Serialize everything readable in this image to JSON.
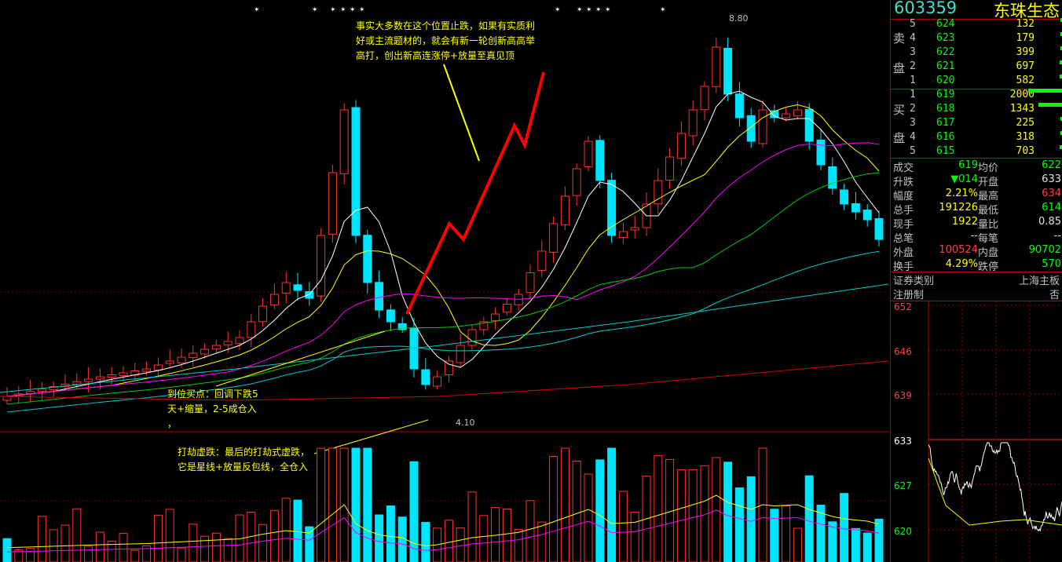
{
  "stock": {
    "code": "603359",
    "name": "东珠生态"
  },
  "chart": {
    "high_label": "8.80",
    "low_label": "4.10",
    "annotation_top": "事实大多数在这个位置止跌，如果有实质利\n好或主流题材的，就会有新一轮创新高高举\n高打，创出新高连涨停+放量至真见顶",
    "annotation_buy": "到位买点：回调下跌5\n天+缩量，2-5成仓入\n，",
    "annotation_fake": "打劫虚跌：最后的打劫式虚跌，\n它是星线+放量反包线，全仓入",
    "colors": {
      "up": "#ff3030",
      "down": "#00e5ff",
      "ma5": "#ffffff",
      "ma10": "#ffff00",
      "ma20": "#ff00ff",
      "ma30": "#00cc00",
      "ma60": "#ffffff",
      "ma120": "#00cccc",
      "ma250": "#cc0000"
    }
  },
  "orderbook": {
    "sell_label": [
      "卖",
      "盘"
    ],
    "buy_label": [
      "买",
      "盘"
    ],
    "sell": [
      {
        "lvl": "5",
        "price": "624",
        "vol": "132",
        "bar": 0.03
      },
      {
        "lvl": "4",
        "price": "623",
        "vol": "179",
        "bar": 0.04
      },
      {
        "lvl": "3",
        "price": "622",
        "vol": "399",
        "bar": 0.07
      },
      {
        "lvl": "2",
        "price": "621",
        "vol": "697",
        "bar": 0.1
      },
      {
        "lvl": "1",
        "price": "620",
        "vol": "582",
        "bar": 0.09
      }
    ],
    "buy": [
      {
        "lvl": "1",
        "price": "619",
        "vol": "2000",
        "bar": 1.0
      },
      {
        "lvl": "2",
        "price": "618",
        "vol": "1343",
        "bar": 0.7
      },
      {
        "lvl": "3",
        "price": "617",
        "vol": "225",
        "bar": 0.05
      },
      {
        "lvl": "4",
        "price": "616",
        "vol": "318",
        "bar": 0.05
      },
      {
        "lvl": "5",
        "price": "615",
        "vol": "703",
        "bar": 0.1
      }
    ]
  },
  "stats": [
    {
      "l1": "成交",
      "v1": "619",
      "c1": "grn",
      "l2": "均价",
      "v2": "622",
      "c2": "grn"
    },
    {
      "l1": "升跌",
      "v1": "▼014",
      "c1": "grn",
      "l2": "开盘",
      "v2": "633",
      "c2": "wht"
    },
    {
      "l1": "幅度",
      "v1": "2.21%",
      "c1": "yel",
      "l2": "最高",
      "v2": "634",
      "c2": "red"
    },
    {
      "l1": "总手",
      "v1": "191226",
      "c1": "yel",
      "l2": "最低",
      "v2": "614",
      "c2": "grn"
    },
    {
      "l1": "现手",
      "v1": "1922",
      "c1": "yel",
      "l2": "量比",
      "v2": "0.85",
      "c2": "wht"
    },
    {
      "l1": "总笔",
      "v1": "--",
      "c1": "wht",
      "l2": "每笔",
      "v2": "--",
      "c2": "wht"
    },
    {
      "l1": "外盘",
      "v1": "100524",
      "c1": "red",
      "l2": "内盘",
      "v2": "90702",
      "c2": "grn"
    },
    {
      "l1": "换手",
      "v1": "4.29%",
      "c1": "yel",
      "l2": "跌停",
      "v2": "570",
      "c2": "grn"
    }
  ],
  "info": [
    {
      "l": "证券类别",
      "v": "上海主板"
    },
    {
      "l": "注册制",
      "v": "否"
    }
  ],
  "mini_axis": [
    "652",
    "646",
    "639",
    "633",
    "627",
    "620"
  ]
}
